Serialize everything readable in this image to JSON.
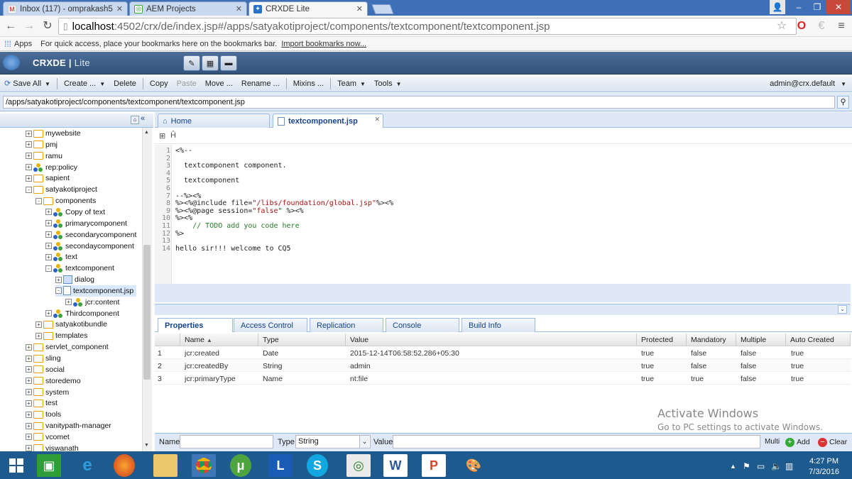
{
  "browser": {
    "tabs": [
      {
        "title": "Inbox (117) - omprakash5",
        "icon": "gmail-icon",
        "active": false
      },
      {
        "title": "AEM Projects",
        "icon": "aem-icon",
        "active": false
      },
      {
        "title": "CRXDE Lite",
        "icon": "crxde-icon",
        "active": true
      }
    ],
    "url_host": "localhost",
    "url_path": ":4502/crx/de/index.jsp#/apps/satyakotiproject/components/textcomponent/textcomponent.jsp",
    "bookmarks": {
      "apps": "Apps",
      "message": "For quick access, place your bookmarks here on the bookmarks bar.",
      "import_link": "Import bookmarks now..."
    }
  },
  "crxde": {
    "title_main": "CRXDE",
    "title_lite": "Lite",
    "toolbar": {
      "save_all": "Save All",
      "create": "Create ...",
      "delete": "Delete",
      "copy": "Copy",
      "paste": "Paste",
      "move": "Move ...",
      "rename": "Rename ...",
      "mixins": "Mixins ...",
      "team": "Team",
      "tools": "Tools"
    },
    "user": "admin@crx.default",
    "path": "/apps/satyakotiproject/components/textcomponent/textcomponent.jsp"
  },
  "tree": {
    "nodes": [
      {
        "label": "mywebsite",
        "depth": 0,
        "kind": "folder",
        "exp": "+"
      },
      {
        "label": "pmj",
        "depth": 0,
        "kind": "folder",
        "exp": "+"
      },
      {
        "label": "ramu",
        "depth": 0,
        "kind": "folder",
        "exp": "+"
      },
      {
        "label": "rep:policy",
        "depth": 0,
        "kind": "comp",
        "exp": "+"
      },
      {
        "label": "sapient",
        "depth": 0,
        "kind": "folder",
        "exp": "+"
      },
      {
        "label": "satyakotiproject",
        "depth": 0,
        "kind": "folder",
        "exp": "-"
      },
      {
        "label": "components",
        "depth": 1,
        "kind": "folder",
        "exp": "-"
      },
      {
        "label": "Copy of text",
        "depth": 2,
        "kind": "comp",
        "exp": "+"
      },
      {
        "label": "primarycomponent",
        "depth": 2,
        "kind": "comp",
        "exp": "+"
      },
      {
        "label": "secondarycomponent",
        "depth": 2,
        "kind": "comp",
        "exp": "+"
      },
      {
        "label": "secondaycomponent",
        "depth": 2,
        "kind": "comp",
        "exp": "+"
      },
      {
        "label": "text",
        "depth": 2,
        "kind": "comp",
        "exp": "+"
      },
      {
        "label": "textcomponent",
        "depth": 2,
        "kind": "comp",
        "exp": "-"
      },
      {
        "label": "dialog",
        "depth": 3,
        "kind": "dialog",
        "exp": "+"
      },
      {
        "label": "textcomponent.jsp",
        "depth": 3,
        "kind": "file",
        "exp": "-",
        "selected": true
      },
      {
        "label": "jcr:content",
        "depth": 4,
        "kind": "comp",
        "exp": "+"
      },
      {
        "label": "Thirdcomponent",
        "depth": 2,
        "kind": "comp",
        "exp": "+"
      },
      {
        "label": "satyakotibundle",
        "depth": 1,
        "kind": "folder",
        "exp": "+"
      },
      {
        "label": "templates",
        "depth": 1,
        "kind": "folder",
        "exp": "+"
      },
      {
        "label": "servlet_component",
        "depth": 0,
        "kind": "folder",
        "exp": "+"
      },
      {
        "label": "sling",
        "depth": 0,
        "kind": "folder",
        "exp": "+"
      },
      {
        "label": "social",
        "depth": 0,
        "kind": "folder",
        "exp": "+"
      },
      {
        "label": "storedemo",
        "depth": 0,
        "kind": "folder",
        "exp": "+"
      },
      {
        "label": "system",
        "depth": 0,
        "kind": "folder",
        "exp": "+"
      },
      {
        "label": "test",
        "depth": 0,
        "kind": "folder",
        "exp": "+"
      },
      {
        "label": "tools",
        "depth": 0,
        "kind": "folder",
        "exp": "+"
      },
      {
        "label": "vanitypath-manager",
        "depth": 0,
        "kind": "folder",
        "exp": "+"
      },
      {
        "label": "vcomet",
        "depth": 0,
        "kind": "folder",
        "exp": "+"
      },
      {
        "label": "viswanath",
        "depth": 0,
        "kind": "folder",
        "exp": "+"
      }
    ]
  },
  "editor": {
    "tabs": {
      "home": "Home",
      "file": "textcomponent.jsp"
    },
    "lines": [
      {
        "n": "1",
        "text": "<%--"
      },
      {
        "n": "2",
        "text": ""
      },
      {
        "n": "3",
        "text": "  textcomponent component."
      },
      {
        "n": "4",
        "text": ""
      },
      {
        "n": "5",
        "text": "  textcomponent"
      },
      {
        "n": "6",
        "text": ""
      },
      {
        "n": "7",
        "text": "--%><%"
      },
      {
        "n": "8",
        "text": "%><%@include file=\"/libs/foundation/global.jsp\"%><%"
      },
      {
        "n": "9",
        "text": "%><%@page session=\"false\" %><%"
      },
      {
        "n": "10",
        "text": "%><%"
      },
      {
        "n": "11",
        "text": "    // TODO add you code here"
      },
      {
        "n": "12",
        "text": "%>"
      },
      {
        "n": "13",
        "text": ""
      },
      {
        "n": "14",
        "text": "hello sir!!! welcome to CQ5"
      }
    ]
  },
  "properties": {
    "tabs": [
      "Properties",
      "Access Control",
      "Replication",
      "Console",
      "Build Info"
    ],
    "columns": [
      "Name",
      "Type",
      "Value",
      "Protected",
      "Mandatory",
      "Multiple",
      "Auto Created"
    ],
    "rows": [
      {
        "idx": "1",
        "name": "jcr:created",
        "type": "Date",
        "value": "2015-12-14T06:58:52.286+05:30",
        "protected": "true",
        "mandatory": "false",
        "multiple": "false",
        "auto": "true"
      },
      {
        "idx": "2",
        "name": "jcr:createdBy",
        "type": "String",
        "value": "admin",
        "protected": "true",
        "mandatory": "false",
        "multiple": "false",
        "auto": "true"
      },
      {
        "idx": "3",
        "name": "jcr:primaryType",
        "type": "Name",
        "value": "nt:file",
        "protected": "true",
        "mandatory": "true",
        "multiple": "false",
        "auto": "true"
      }
    ],
    "add": {
      "name_label": "Name",
      "type_label": "Type",
      "type_value": "String",
      "value_label": "Value",
      "multi": "Multi",
      "add_btn": "Add",
      "clear_btn": "Clear"
    }
  },
  "watermark": {
    "line1": "Activate Windows",
    "line2": "Go to PC settings to activate Windows."
  },
  "taskbar": {
    "time": "4:27 PM",
    "date": "7/3/2016"
  }
}
